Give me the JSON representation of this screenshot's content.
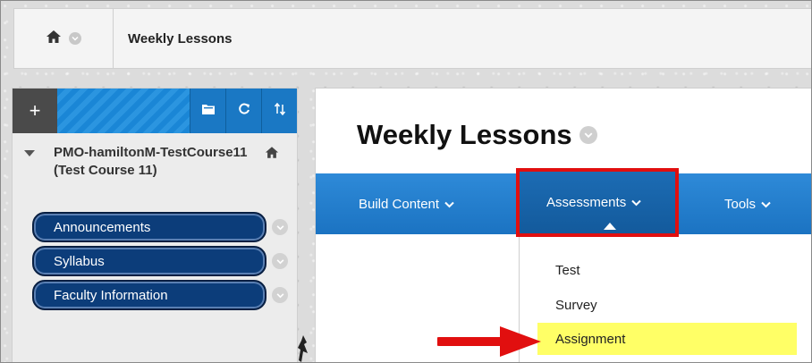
{
  "breadcrumb": {
    "home_icon": "home-icon",
    "title": "Weekly Lessons"
  },
  "course_menu": {
    "toolbar": {
      "add_label": "+",
      "icons": [
        "folder-icon",
        "refresh-icon",
        "sort-icon"
      ]
    },
    "course_title": "PMO-hamiltonM-TestCourse11 (Test Course 11)",
    "items": [
      {
        "label": "Announcements"
      },
      {
        "label": "Syllabus"
      },
      {
        "label": "Faculty Information"
      }
    ]
  },
  "content": {
    "title": "Weekly Lessons",
    "actions": [
      {
        "label": "Build Content"
      },
      {
        "label": "Assessments"
      },
      {
        "label": "Tools"
      }
    ],
    "dropdown": [
      {
        "label": "Test"
      },
      {
        "label": "Survey"
      },
      {
        "label": "Assignment"
      }
    ]
  },
  "colors": {
    "accent_blue": "#1b73c2",
    "menu_pill": "#0c3d7a",
    "highlight_box": "#e10f0f",
    "highlight_row": "#ffff66"
  }
}
